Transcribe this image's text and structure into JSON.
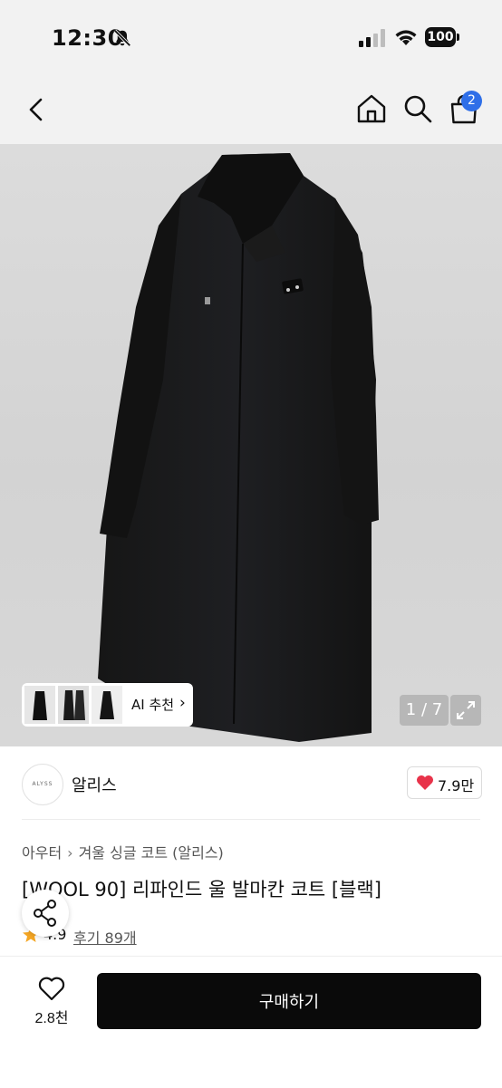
{
  "status_bar": {
    "time": "12:30",
    "battery": "100"
  },
  "nav": {
    "cart_count": "2"
  },
  "gallery": {
    "ai_label": "AI 추천",
    "page_indicator": "1 / 7"
  },
  "brand": {
    "logo_text": "ALYSS",
    "name": "알리스",
    "likes": "7.9만"
  },
  "product": {
    "breadcrumb": [
      "아우터",
      "겨울 싱글 코트 (알리스)"
    ],
    "title": "[WOOL 90] 리파인드 울 발마칸 코트 [블랙]",
    "rating": "4.9",
    "reviews": "후기 89개"
  },
  "bottom_bar": {
    "wish_count": "2.8천",
    "buy_label": "구매하기"
  },
  "colors": {
    "accent_badge": "#2f6fe8",
    "heart": "#e8334a",
    "star": "#f5a623",
    "buy_button": "#0a0a0a"
  },
  "icons": [
    "bell-slash-icon",
    "signal-icon",
    "wifi-icon",
    "battery-icon",
    "back-chevron-icon",
    "home-icon",
    "search-icon",
    "cart-icon",
    "chevron-right-icon",
    "expand-icon",
    "heart-icon",
    "star-icon",
    "share-icon"
  ]
}
